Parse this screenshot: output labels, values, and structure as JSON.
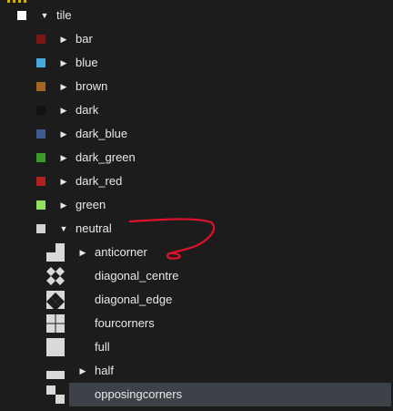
{
  "tree": {
    "root": {
      "label": "tile",
      "expanded": true,
      "swatch": "#ffffff"
    },
    "children": [
      {
        "label": "bar",
        "color": "#7a1712",
        "expanded": false
      },
      {
        "label": "blue",
        "color": "#45a9df",
        "expanded": false
      },
      {
        "label": "brown",
        "color": "#a5641f",
        "expanded": false
      },
      {
        "label": "dark",
        "color": "#121212",
        "expanded": false
      },
      {
        "label": "dark_blue",
        "color": "#3e5b8d",
        "expanded": false
      },
      {
        "label": "dark_green",
        "color": "#3a9b2a",
        "expanded": false
      },
      {
        "label": "dark_red",
        "color": "#b1201c",
        "expanded": false
      },
      {
        "label": "green",
        "color": "#93e05e",
        "expanded": false
      },
      {
        "label": "neutral",
        "color": "#d2d2d2",
        "expanded": true
      }
    ],
    "neutral_children": [
      {
        "label": "anticorner",
        "icon": "anticorner-thumb-icon",
        "expanded": false
      },
      {
        "label": "diagonal_centre",
        "icon": "diagonal-centre-thumb-icon"
      },
      {
        "label": "diagonal_edge",
        "icon": "diagonal-edge-thumb-icon"
      },
      {
        "label": "fourcorners",
        "icon": "fourcorners-thumb-icon"
      },
      {
        "label": "full",
        "icon": "full-thumb-icon"
      },
      {
        "label": "half",
        "icon": "half-thumb-icon",
        "expanded": false
      },
      {
        "label": "opposingcorners",
        "icon": "opposingcorners-thumb-icon",
        "selected": true
      }
    ]
  },
  "colors": {
    "background": "#1c1c1c",
    "selection": "#3d4248",
    "annotation": "#e0102a",
    "neutral_tile": "#d9d9d9"
  }
}
